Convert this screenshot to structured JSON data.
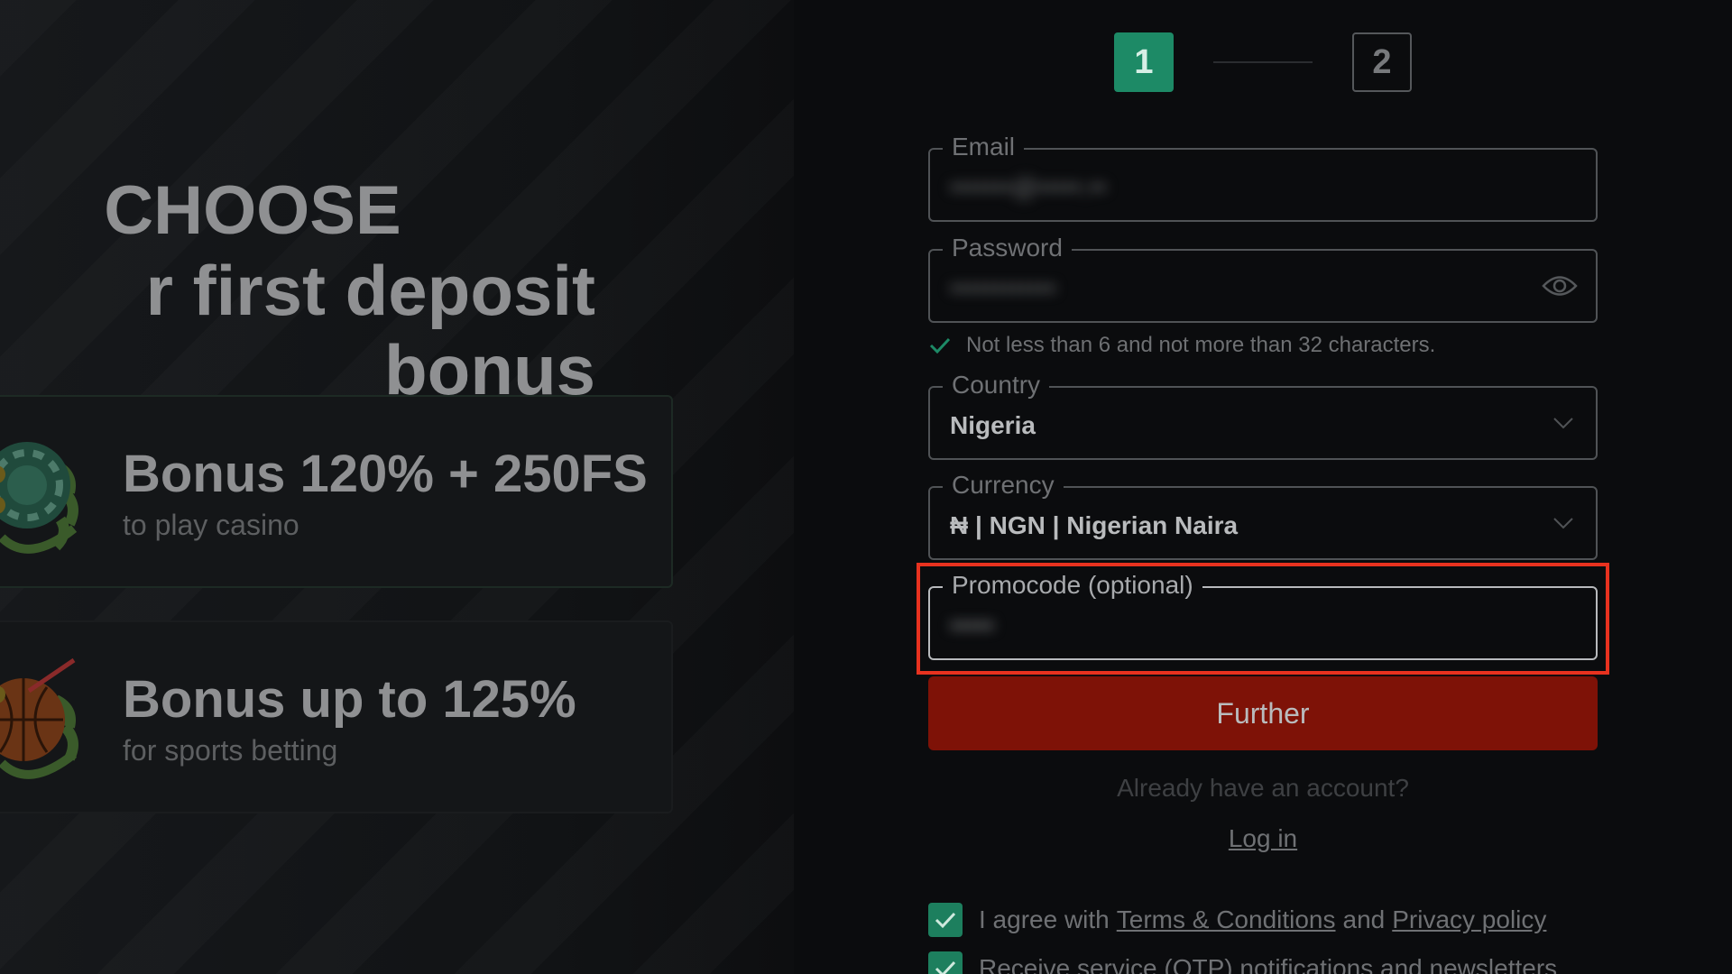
{
  "hero": {
    "line1": "CHOOSE",
    "line2": "r first deposit bonus"
  },
  "bonuses": [
    {
      "title": "Bonus 120% + 250FS",
      "subtitle": "to play casino",
      "icon": "casino-chip-icon"
    },
    {
      "title": "Bonus up to 125%",
      "subtitle": "for sports betting",
      "icon": "basketball-icon"
    }
  ],
  "stepper": {
    "step1": "1",
    "step2": "2",
    "active_color": "#1d8a66"
  },
  "form": {
    "email": {
      "label": "Email",
      "value": "•••••••@•••••.••"
    },
    "password": {
      "label": "Password",
      "value": "••••••••••••",
      "icon": "eye-icon"
    },
    "password_hint": "Not less than 6 and not more than 32 characters.",
    "country": {
      "label": "Country",
      "value": "Nigeria"
    },
    "currency": {
      "label": "Currency",
      "value": "₦ | NGN | Nigerian Naira"
    },
    "promocode": {
      "label": "Promocode (optional)",
      "value": "•••••"
    },
    "submit_label": "Further",
    "already_text": "Already have an account?",
    "login_label": "Log in",
    "agree": {
      "prefix": "I agree with",
      "terms": "Terms & Conditions",
      "and": "and",
      "privacy": "Privacy policy"
    },
    "notifications_text": "Receive service (OTP) notifications and newsletters"
  },
  "colors": {
    "accent_green": "#1d8a66",
    "submit_red": "#7e1207",
    "highlight_red": "#e8321f"
  }
}
